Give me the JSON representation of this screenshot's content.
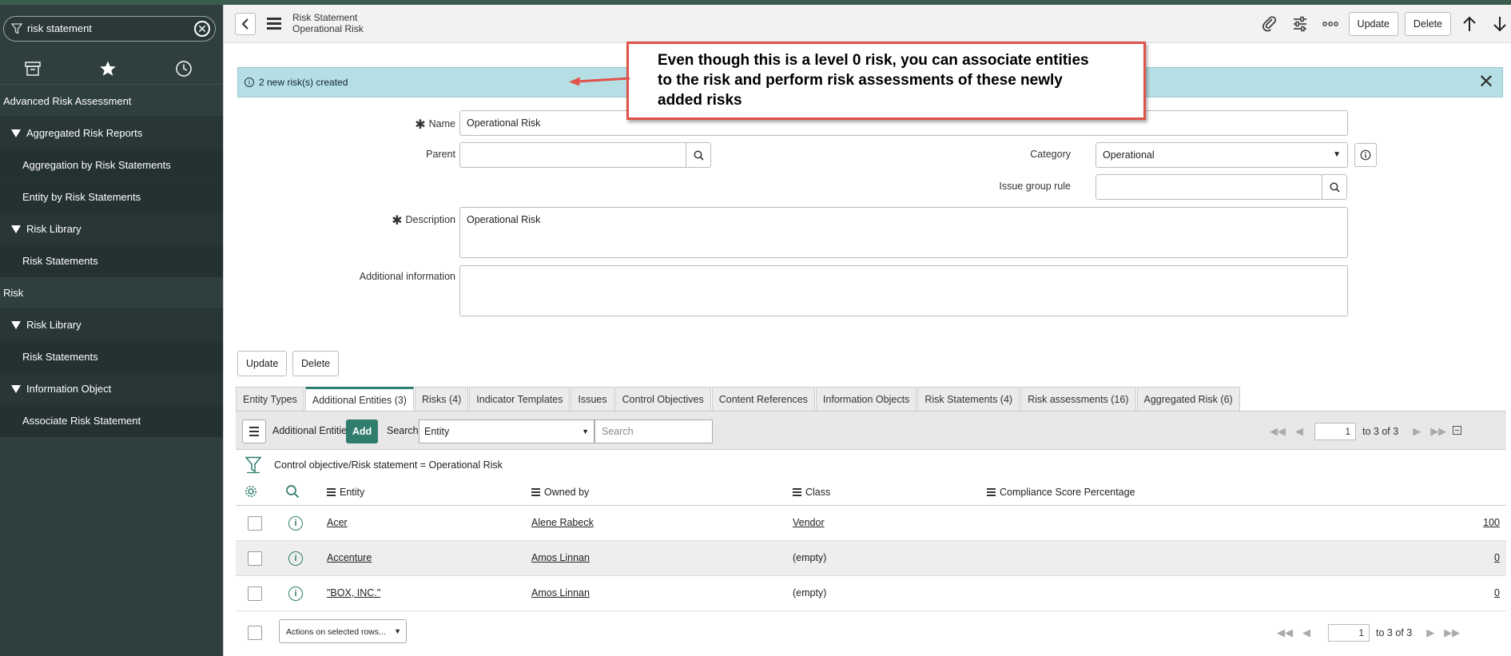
{
  "sidebar": {
    "filter_value": "risk statement",
    "nav": [
      {
        "type": "app",
        "label": "Advanced Risk Assessment"
      },
      {
        "type": "module",
        "label": "Aggregated Risk Reports"
      },
      {
        "type": "item",
        "label": "Aggregation by Risk Statements"
      },
      {
        "type": "item",
        "label": "Entity by Risk Statements"
      },
      {
        "type": "module",
        "label": "Risk Library"
      },
      {
        "type": "item",
        "label": "Risk Statements"
      },
      {
        "type": "app",
        "label": "Risk"
      },
      {
        "type": "module",
        "label": "Risk Library"
      },
      {
        "type": "item",
        "label": "Risk Statements"
      },
      {
        "type": "module",
        "label": "Information Object"
      },
      {
        "type": "item",
        "label": "Associate Risk Statement"
      }
    ]
  },
  "header": {
    "record_type": "Risk Statement",
    "record_name": "Operational Risk",
    "update_label": "Update",
    "delete_label": "Delete"
  },
  "banner": {
    "message": "2 new risk(s) created",
    "close": "✕"
  },
  "callout": {
    "text": "Even though this is a level 0 risk, you can associate entities to the risk and perform risk assessments of these  newly added risks"
  },
  "form": {
    "name_label": "Name",
    "name_value": "Operational Risk",
    "parent_label": "Parent",
    "parent_value": "",
    "category_label": "Category",
    "category_value": "Operational",
    "issue_group_label": "Issue group rule",
    "issue_group_value": "",
    "description_label": "Description",
    "description_value": "Operational Risk",
    "additional_info_label": "Additional information",
    "additional_info_value": "",
    "update_label": "Update",
    "delete_label": "Delete"
  },
  "tabs": [
    "Entity Types",
    "Additional Entities (3)",
    "Risks (4)",
    "Indicator Templates",
    "Issues",
    "Control Objectives",
    "Content References",
    "Information Objects",
    "Risk Statements (4)",
    "Risk assessments (16)",
    "Aggregated Risk (6)"
  ],
  "active_tab": 1,
  "list": {
    "title": "Additional Entities",
    "add_label": "Add",
    "search_label": "Search",
    "search_field": "Entity",
    "search_placeholder": "Search",
    "page_value": "1",
    "page_range": "to 3 of 3",
    "filter_text": "Control objective/Risk statement = Operational Risk",
    "columns": [
      "Entity",
      "Owned by",
      "Class",
      "Compliance Score Percentage"
    ],
    "rows": [
      {
        "entity": "Acer",
        "owned_by": "Alene Rabeck",
        "class": "Vendor",
        "score": "100"
      },
      {
        "entity": "Accenture",
        "owned_by": "Amos Linnan",
        "class": "(empty)",
        "score": "0"
      },
      {
        "entity": "\"BOX, INC.\"",
        "owned_by": "Amos Linnan",
        "class": "(empty)",
        "score": "0"
      }
    ],
    "actions_label": "Actions on selected rows..."
  },
  "colors": {
    "accent": "#2f7d6d",
    "banner": "#b6dfe5",
    "callout_border": "#e0524a",
    "sidebar": "#2f3e3e"
  }
}
